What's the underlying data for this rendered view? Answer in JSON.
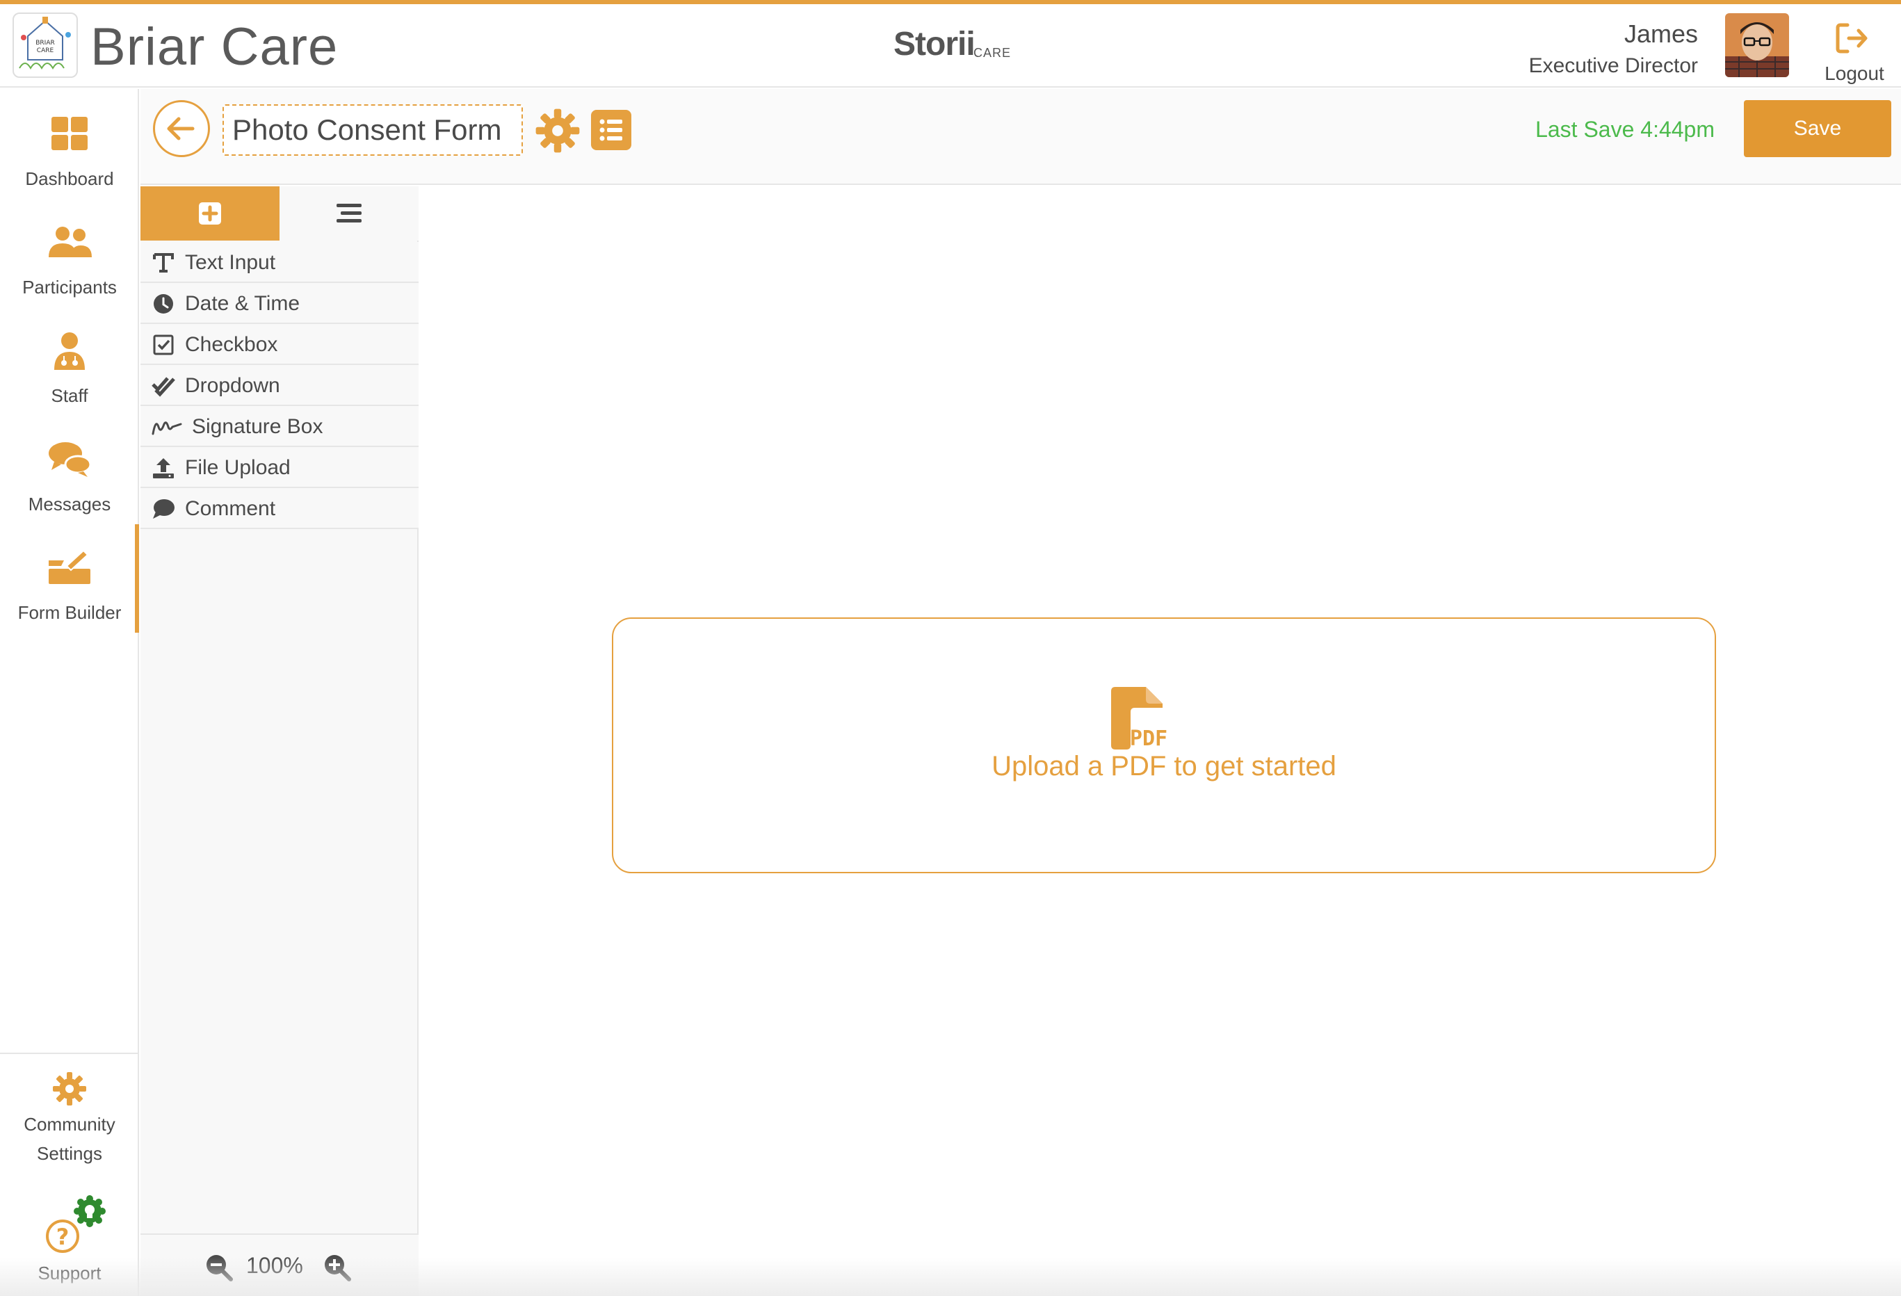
{
  "header": {
    "brand_name": "Briar Care",
    "storii_brand": "Storii",
    "storii_sub": "CARE",
    "user_name": "James",
    "user_role": "Executive Director",
    "logout_label": "Logout",
    "accent_color": "#e5a03f"
  },
  "nav": {
    "items": [
      {
        "label": "Dashboard",
        "icon": "dashboard-icon"
      },
      {
        "label": "Participants",
        "icon": "participants-icon"
      },
      {
        "label": "Staff",
        "icon": "staff-icon"
      },
      {
        "label": "Messages",
        "icon": "messages-icon"
      },
      {
        "label": "Form Builder",
        "icon": "form-builder-icon",
        "active": true
      }
    ],
    "bottom": [
      {
        "label_line1": "Community",
        "label_line2": "Settings",
        "icon": "gear-icon"
      },
      {
        "label": "Support",
        "icon": "help-icon"
      }
    ]
  },
  "toolbar": {
    "form_title": "Photo Consent Form",
    "last_save": "Last Save 4:44pm",
    "save_label": "Save",
    "save_color": "#4cba4c"
  },
  "panel": {
    "components": [
      {
        "label": "Text Input",
        "icon": "text-icon"
      },
      {
        "label": "Date & Time",
        "icon": "clock-icon"
      },
      {
        "label": "Checkbox",
        "icon": "checkbox-icon"
      },
      {
        "label": "Dropdown",
        "icon": "double-check-icon"
      },
      {
        "label": "Signature Box",
        "icon": "signature-icon"
      },
      {
        "label": "File Upload",
        "icon": "upload-icon"
      },
      {
        "label": "Comment",
        "icon": "comment-icon"
      }
    ],
    "zoom_level": "100%"
  },
  "canvas": {
    "dropzone_text": "Upload a PDF to get started",
    "pdf_icon_text": "PDF"
  }
}
